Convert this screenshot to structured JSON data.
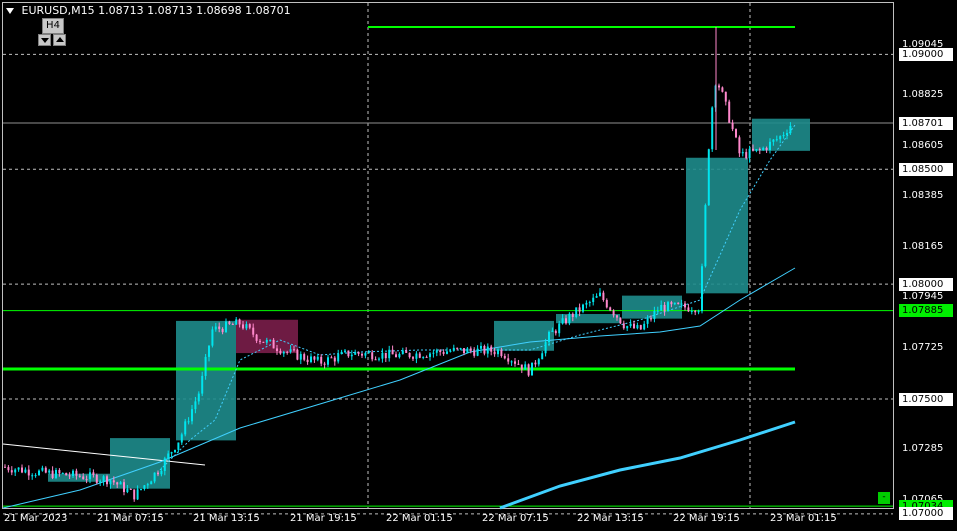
{
  "header": {
    "symbol": "EURUSD,M15",
    "ohlc": "1.08713 1.08713 1.08698 1.08701"
  },
  "timeframe": {
    "label": "H4",
    "down_icon": "triangle-down-icon",
    "up_icon": "triangle-up-icon"
  },
  "price_axis": [
    {
      "text": "1.09045",
      "style": "plain",
      "price": 1.09045
    },
    {
      "text": "1.09000",
      "style": "boxed",
      "price": 1.09
    },
    {
      "text": "1.08825",
      "style": "plain",
      "price": 1.08825
    },
    {
      "text": "1.08701",
      "style": "boxed",
      "price": 1.08701
    },
    {
      "text": "1.08605",
      "style": "plain",
      "price": 1.08605
    },
    {
      "text": "1.08500",
      "style": "boxed",
      "price": 1.085
    },
    {
      "text": "1.08385",
      "style": "plain",
      "price": 1.08385
    },
    {
      "text": "1.08165",
      "style": "plain",
      "price": 1.08165
    },
    {
      "text": "1.08000",
      "style": "boxed",
      "price": 1.08
    },
    {
      "text": "1.07945",
      "style": "plain",
      "price": 1.07945
    },
    {
      "text": "1.07885",
      "style": "green",
      "price": 1.07885
    },
    {
      "text": "1.07725",
      "style": "plain",
      "price": 1.07725
    },
    {
      "text": "1.07500",
      "style": "boxed",
      "price": 1.075
    },
    {
      "text": "1.07285",
      "style": "plain",
      "price": 1.07285
    },
    {
      "text": "1.07065",
      "style": "plain",
      "price": 1.07065
    },
    {
      "text": "1.07034",
      "style": "green",
      "price": 1.07034
    },
    {
      "text": "1.07000",
      "style": "boxed",
      "price": 1.07
    }
  ],
  "time_axis": [
    "21 Mar 2023",
    "21 Mar 07:15",
    "21 Mar 13:15",
    "21 Mar 19:15",
    "22 Mar 01:15",
    "22 Mar 07:15",
    "22 Mar 13:15",
    "22 Mar 19:15",
    "23 Mar 01:15"
  ],
  "colors": {
    "background": "#000000",
    "candle_up": "#00e5ee",
    "candle_down": "#ff88cc",
    "box_up": "#1e8c8c",
    "box_down": "#7a1e4a",
    "level_green": "#00ff00",
    "ma": "#40d0ff",
    "grid": "#c0c0c0"
  },
  "legend_button": "-"
}
